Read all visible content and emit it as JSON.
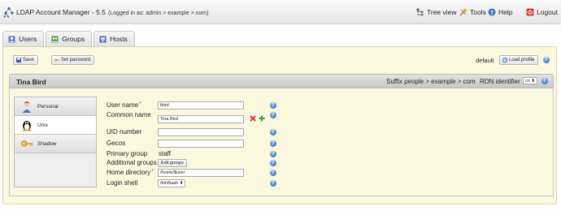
{
  "app": {
    "title": "LDAP Account Manager - 5.5",
    "login_info": "(Logged in as: admin > example > com)"
  },
  "topnav": {
    "tree_view": "Tree view",
    "tools": "Tools",
    "help": "Help",
    "logout": "Logout"
  },
  "tabs": [
    {
      "label": "Users",
      "icon": "users-icon"
    },
    {
      "label": "Groups",
      "icon": "groups-icon"
    },
    {
      "label": "Hosts",
      "icon": "hosts-icon"
    }
  ],
  "toolbar": {
    "save_label": "Save",
    "set_password_label": "Set password",
    "profile_name": "default",
    "load_profile_label": "Load profile"
  },
  "account": {
    "title": "Tina Bird",
    "suffix_label": "Suffix",
    "suffix_value": "people > example > com",
    "rdn_label": "RDN identifier",
    "rdn_value": "cn"
  },
  "modules": [
    {
      "label": "Personal",
      "icon": "personal-icon"
    },
    {
      "label": "Unix",
      "icon": "tux-icon"
    },
    {
      "label": "Shadow",
      "icon": "key-icon"
    }
  ],
  "form": {
    "user_name_label": "User name",
    "user_name_value": "tbird",
    "common_name_label": "Common name",
    "common_name_value": "Tina Bird",
    "uid_label": "UID number",
    "uid_value": "",
    "gecos_label": "Gecos",
    "gecos_value": "",
    "primary_group_label": "Primary group",
    "primary_group_value": "staff",
    "additional_groups_label": "Additional groups",
    "edit_groups_label": "Edit groups",
    "home_dir_label": "Home directory",
    "home_dir_value": "/home/$user",
    "login_shell_label": "Login shell",
    "login_shell_value": "/bin/bash"
  },
  "colors": {
    "panel_bg": "#fbf8e0",
    "required_star": "#dd3333",
    "help_icon": "#2f63b2"
  }
}
